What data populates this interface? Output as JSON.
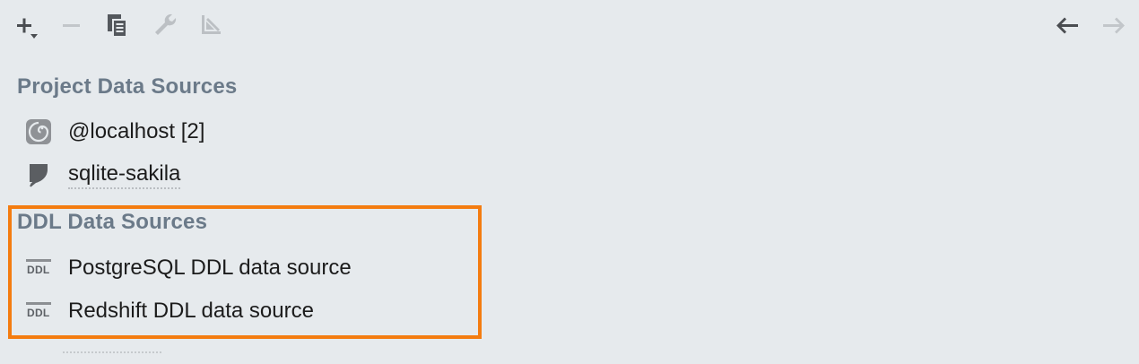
{
  "toolbar": {
    "buttons": [
      {
        "name": "add-button",
        "icon": "plus-with-dropdown-icon",
        "enabled": true
      },
      {
        "name": "remove-button",
        "icon": "minus-icon",
        "enabled": false
      },
      {
        "name": "duplicate-button",
        "icon": "copy-icon",
        "enabled": true
      },
      {
        "name": "driver-settings-button",
        "icon": "wrench-icon",
        "enabled": false
      },
      {
        "name": "import-button",
        "icon": "arrow-down-left-icon",
        "enabled": false
      },
      {
        "name": "back-button",
        "icon": "arrow-left-icon",
        "enabled": true
      },
      {
        "name": "forward-button",
        "icon": "arrow-right-icon",
        "enabled": false
      }
    ]
  },
  "project_sources": {
    "header": "Project Data Sources",
    "items": [
      {
        "label": "@localhost [2]",
        "icon": "postgresql-elephant-icon"
      },
      {
        "label": "sqlite-sakila",
        "icon": "sqlite-feather-icon"
      }
    ]
  },
  "ddl_sources": {
    "header": "DDL Data Sources",
    "icon_text": "DDL",
    "items": [
      {
        "label": "PostgreSQL DDL data source",
        "icon": "ddl-icon"
      },
      {
        "label": "Redshift DDL data source",
        "icon": "ddl-icon"
      }
    ]
  },
  "colors": {
    "background": "#e6eaed",
    "section_header": "#6b7a89",
    "highlight": "#f47c10",
    "icon_active": "#4a4d51",
    "icon_disabled": "#b6babe"
  }
}
